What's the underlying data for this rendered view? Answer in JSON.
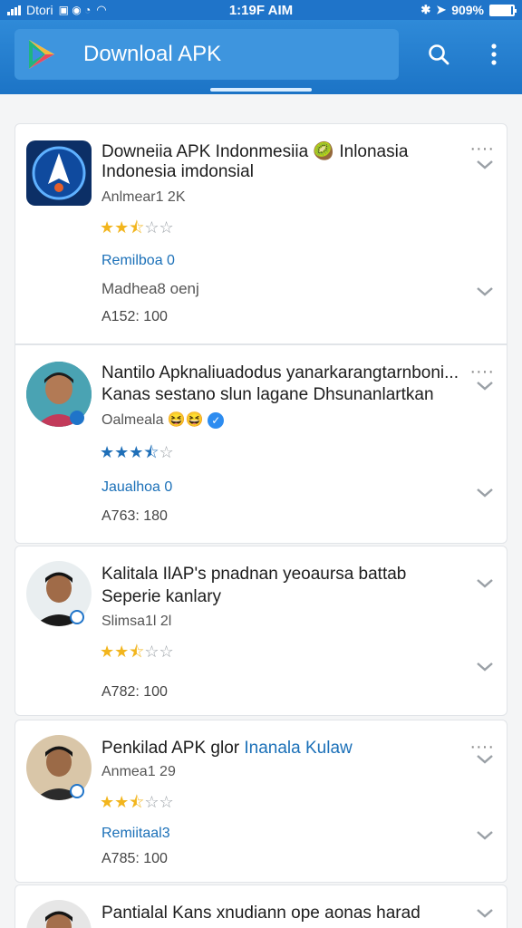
{
  "status": {
    "left_text": "Dtori",
    "time": "1:19F AIM",
    "battery": "909%",
    "battery_level": 0.9
  },
  "appbar": {
    "title": "Downloal APK",
    "search_icon": "search-icon",
    "menu_icon": "more-vertical-icon"
  },
  "cards": [
    {
      "title_line1": "Downeiia APK Indonmesiia 🥝 Inlonasia",
      "title_line2": "Indonesia imdonsial",
      "meta": "Anlmear1 2K",
      "rating": 2.5,
      "link": "Remilboa 0",
      "sub": "Madhea8 oenj",
      "count": "A152: 100"
    },
    {
      "title_line1": "Nantilo Apknaliuadodus yanarkarangtarnboni...",
      "title_line2": "Kanas sestano slun lagane Dhsunanlartkan",
      "meta": "Oalmeala 😆😆",
      "rating": 3.5,
      "link": "Jaualhoa 0",
      "count": "A763: 180"
    },
    {
      "title_line1": "Kalitala IlAP's pnadnan yeoaursa battab",
      "title_line2": "Seperie kanlary",
      "meta": "Slimsa1l 2l",
      "rating": 2.5,
      "count": "A782: 100"
    },
    {
      "title_line1a": "Penkilad APK glor",
      "title_line1b": " Inanala Kulaw",
      "meta": "Anmea1 29",
      "rating": 2.5,
      "link": "Remiitaal3",
      "count": "A785: 100"
    },
    {
      "title_line1": "Pantialal Kans xnudiann ope aonas harad"
    }
  ]
}
